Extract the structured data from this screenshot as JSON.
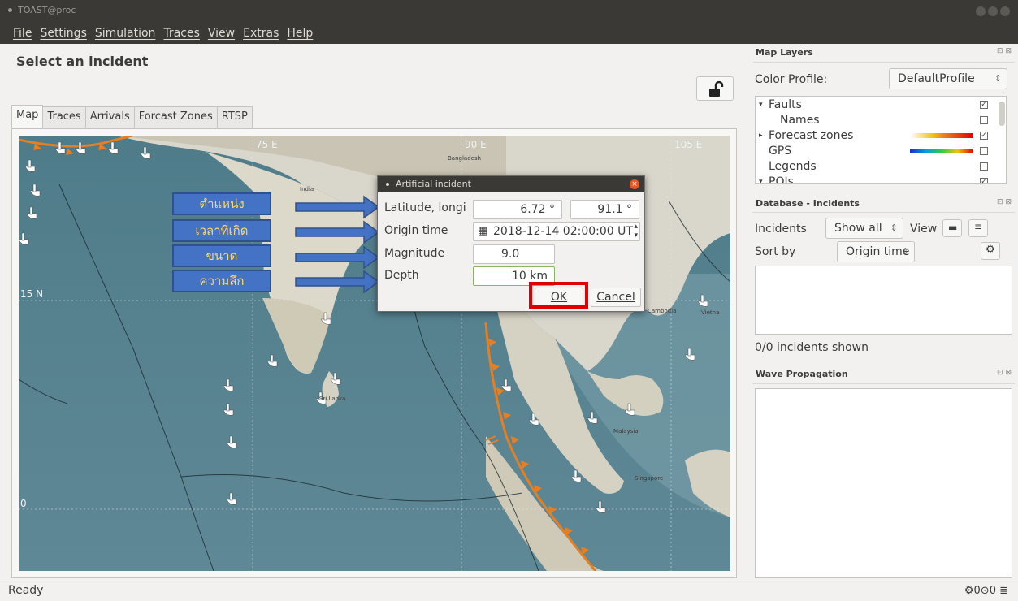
{
  "window": {
    "title": "TOAST@proc"
  },
  "menu": [
    "File",
    "Settings",
    "Simulation",
    "Traces",
    "View",
    "Extras",
    "Help"
  ],
  "page": {
    "title": "Select an incident"
  },
  "tabs": [
    "Map",
    "Traces",
    "Arrivals",
    "Forcast Zones",
    "RTSP"
  ],
  "map": {
    "grid_labels": {
      "lon1": "75 E",
      "lon2": "90 E",
      "lon3": "105 E",
      "lat1": "15 N",
      "lat2": "0"
    },
    "places": {
      "india": "India",
      "bangladesh": "Bangladesh",
      "srilanka": "Sri Lanka",
      "cambodia": "Cambodia",
      "vietnam": "Vietna",
      "malaysia": "Malaysia",
      "singapore": "Singapore"
    }
  },
  "callouts": [
    "ตำแหน่ง",
    "เวลาที่เกิด",
    "ขนาด",
    "ความลึก"
  ],
  "dialog": {
    "title": "Artificial incident",
    "lat_label": "Latitude, longi",
    "latitude": "6.72 °",
    "longitude": "91.1 °",
    "origin_label": "Origin time",
    "origin_time": "2018-12-14 02:00:00 UT",
    "magnitude_label": "Magnitude",
    "magnitude": "9.0",
    "depth_label": "Depth",
    "depth": "10  km",
    "ok": "OK",
    "cancel": "Cancel"
  },
  "map_layers": {
    "title": "Map Layers",
    "color_profile_label": "Color Profile:",
    "color_profile": "DefaultProfile",
    "items": [
      {
        "label": "Faults",
        "checked": true,
        "expander": "▾"
      },
      {
        "label": "Names",
        "checked": false,
        "expander": ""
      },
      {
        "label": "Forecast zones",
        "checked": true,
        "expander": "▸"
      },
      {
        "label": "GPS",
        "checked": false,
        "expander": ""
      },
      {
        "label": "Legends",
        "checked": false,
        "expander": ""
      },
      {
        "label": "POIs",
        "checked": true,
        "expander": "▾"
      }
    ]
  },
  "db_incidents": {
    "title": "Database - Incidents",
    "incidents_label": "Incidents",
    "incidents_filter": "Show all",
    "view_label": "View",
    "sort_label": "Sort by",
    "sort_value": "Origin time",
    "count_text": "0/0 incidents shown"
  },
  "wave_propagation": {
    "title": "Wave Propagation"
  },
  "status": {
    "text": "Ready",
    "right": "⚙0⊙0 ≣"
  },
  "colors": {
    "accent_blue": "#4472c4",
    "callout_text": "#ffd966",
    "highlight_red": "#e10000",
    "titlebar": "#3a3935",
    "close_orange": "#e95420"
  }
}
